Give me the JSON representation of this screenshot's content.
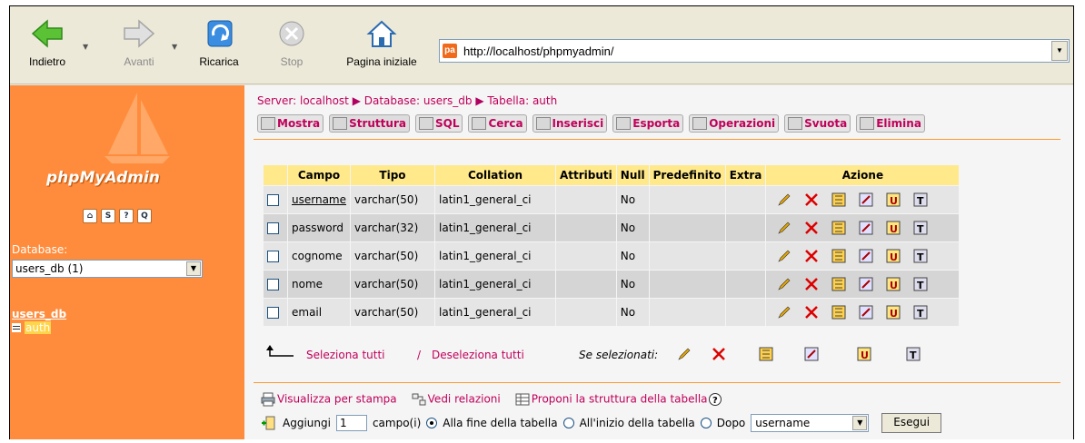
{
  "toolbar": {
    "back_label": "Indietro",
    "forward_label": "Avanti",
    "refresh_label": "Ricarica",
    "stop_label": "Stop",
    "home_label": "Pagina iniziale",
    "address_url": "http://localhost/phpmyadmin/"
  },
  "left": {
    "logo_text": "phpMyAdmin",
    "database_label": "Database:",
    "database_selected": "users_db (1)",
    "db_name": "users_db",
    "table_link": "auth"
  },
  "breadcrumb": {
    "server": "Server: localhost",
    "database": "Database: users_db",
    "table": "Tabella: auth"
  },
  "tabs": [
    "Mostra",
    "Struttura",
    "SQL",
    "Cerca",
    "Inserisci",
    "Esporta",
    "Operazioni",
    "Svuota",
    "Elimina"
  ],
  "columns": [
    "Campo",
    "Tipo",
    "Collation",
    "Attributi",
    "Null",
    "Predefinito",
    "Extra",
    "Azione"
  ],
  "rows": [
    {
      "campo": "username",
      "tipo": "varchar(50)",
      "collation": "latin1_general_ci",
      "attributi": "",
      "null": "No",
      "predefinito": "",
      "extra": ""
    },
    {
      "campo": "password",
      "tipo": "varchar(32)",
      "collation": "latin1_general_ci",
      "attributi": "",
      "null": "No",
      "predefinito": "",
      "extra": ""
    },
    {
      "campo": "cognome",
      "tipo": "varchar(50)",
      "collation": "latin1_general_ci",
      "attributi": "",
      "null": "No",
      "predefinito": "",
      "extra": ""
    },
    {
      "campo": "nome",
      "tipo": "varchar(50)",
      "collation": "latin1_general_ci",
      "attributi": "",
      "null": "No",
      "predefinito": "",
      "extra": ""
    },
    {
      "campo": "email",
      "tipo": "varchar(50)",
      "collation": "latin1_general_ci",
      "attributi": "",
      "null": "No",
      "predefinito": "",
      "extra": ""
    }
  ],
  "selection": {
    "select_all": "Seleziona tutti",
    "separator": "/",
    "deselect_all": "Deseleziona tutti",
    "with_selected": "Se selezionati:"
  },
  "footer": {
    "print_view": "Visualizza per stampa",
    "relations": "Vedi relazioni",
    "propose": "Proponi la struttura della tabella",
    "add_label": "Aggiungi",
    "add_count": "1",
    "field_label": "campo(i)",
    "at_end": "Alla fine della tabella",
    "at_start": "All'inizio della tabella",
    "after": "Dopo",
    "after_field": "username",
    "execute": "Esegui"
  },
  "colors": {
    "left_bg": "#ff8c3c",
    "link": "#c0005a",
    "header_bg": "#ffe98a"
  }
}
